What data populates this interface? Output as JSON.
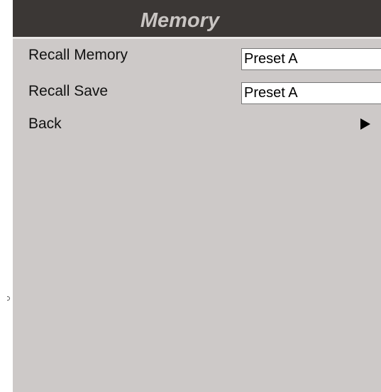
{
  "window": {
    "title": "Memory"
  },
  "menu": {
    "items": [
      {
        "label": "Recall Memory",
        "value": "Preset A"
      },
      {
        "label": "Recall Save",
        "value": "Preset A"
      },
      {
        "label": "Back",
        "icon": "right-triangle-arrow-icon"
      }
    ]
  },
  "colors": {
    "header_bg": "#3b3735",
    "header_text": "#c9c5c3",
    "panel_bg": "#cdc9c8",
    "value_bg": "#ffffff",
    "text": "#111111"
  }
}
